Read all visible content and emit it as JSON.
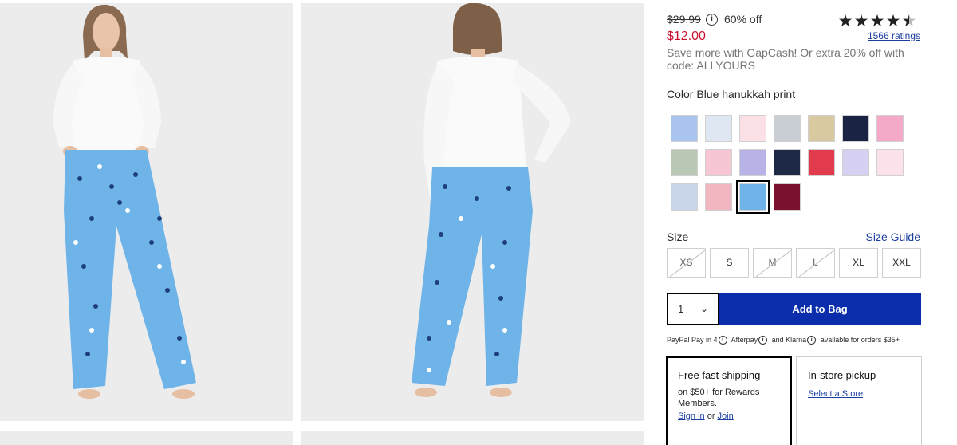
{
  "price": {
    "original": "$29.99",
    "discount": "60% off",
    "sale": "$12.00",
    "promo": "Save more with GapCash! Or extra 20% off with code: ALLYOURS"
  },
  "rating": {
    "stars": 4.5,
    "count_label": "1566 ratings"
  },
  "color": {
    "label": "Color",
    "selected_name": "Blue hanukkah print"
  },
  "swatches": [
    {
      "name": "blue-stripe",
      "bg": "#a9c4ee"
    },
    {
      "name": "light-blue-print",
      "bg": "#dfe7f3"
    },
    {
      "name": "pink-hearts",
      "bg": "#fbe0e6"
    },
    {
      "name": "gray-heart",
      "bg": "#c9cdd4"
    },
    {
      "name": "tan-stripe",
      "bg": "#d9c9a0"
    },
    {
      "name": "navy-dots",
      "bg": "#1b2344"
    },
    {
      "name": "pink-stripe",
      "bg": "#f3a9c7"
    },
    {
      "name": "green-plaid",
      "bg": "#b9c8b4"
    },
    {
      "name": "pink-cherries",
      "bg": "#f6c6d3"
    },
    {
      "name": "purple-plaid",
      "bg": "#b8b3e6"
    },
    {
      "name": "navy-floral",
      "bg": "#1e2a45"
    },
    {
      "name": "red-plaid",
      "bg": "#e23b4e"
    },
    {
      "name": "lavender-print",
      "bg": "#d6d0f2"
    },
    {
      "name": "pale-pink",
      "bg": "#fbe1ea"
    },
    {
      "name": "blue-white-stripe",
      "bg": "#c9d5ea"
    },
    {
      "name": "pink-stripe-print",
      "bg": "#f2b6c1"
    },
    {
      "name": "blue-hanukkah-print",
      "bg": "#6fb4e8"
    },
    {
      "name": "burgundy-bow",
      "bg": "#7a1230"
    }
  ],
  "size": {
    "label": "Size",
    "guide_label": "Size Guide",
    "options": [
      "XS",
      "S",
      "M",
      "L",
      "XL",
      "XXL"
    ],
    "unavailable": [
      "XS",
      "M",
      "L"
    ]
  },
  "cart": {
    "quantity": "1",
    "add_label": "Add to Bag"
  },
  "paylater": {
    "paypal": "PayPal Pay in 4",
    "afterpay": "Afterpay",
    "and": "and",
    "klarna": "Klarna",
    "suffix": "available for orders $35+"
  },
  "shipping": {
    "title": "Free fast shipping",
    "desc": "on $50+ for Rewards Members.",
    "sign_in": "Sign in",
    "or": "or",
    "join": "Join"
  },
  "pickup": {
    "title": "In-store pickup",
    "link": "Select a Store"
  },
  "colors": {
    "sale_red": "#c8102e",
    "cta_blue": "#0a2eab",
    "link_blue": "#1a3fa0",
    "pants_blue": "#6fb4e8"
  }
}
